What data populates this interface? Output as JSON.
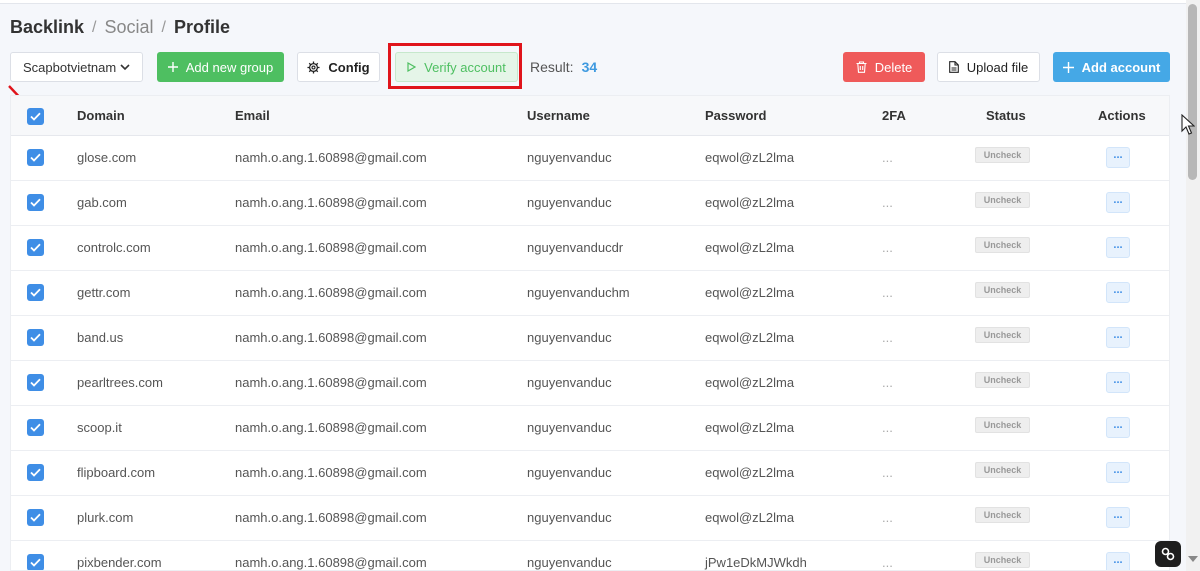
{
  "breadcrumb": {
    "root": "Backlink",
    "sep1": "/",
    "mid": "Social",
    "sep2": "/",
    "current": "Profile"
  },
  "toolbar": {
    "group_select": "Scapbotvietnam",
    "add_group": "Add new group",
    "config": "Config",
    "verify": "Verify account",
    "result_label": "Result:",
    "result_value": "34",
    "delete": "Delete",
    "upload": "Upload file",
    "add_account": "Add account"
  },
  "table": {
    "headers": {
      "domain": "Domain",
      "email": "Email",
      "username": "Username",
      "password": "Password",
      "twofa": "2FA",
      "status": "Status",
      "actions": "Actions"
    },
    "rows": [
      {
        "domain": "glose.com",
        "email": "namh.o.ang.1.60898@gmail.com",
        "username": "nguyenvanduc",
        "password": "eqwol@zL2lma",
        "twofa": "...",
        "status": "Uncheck",
        "action": "..."
      },
      {
        "domain": "gab.com",
        "email": "namh.o.ang.1.60898@gmail.com",
        "username": "nguyenvanduc",
        "password": "eqwol@zL2lma",
        "twofa": "...",
        "status": "Uncheck",
        "action": "..."
      },
      {
        "domain": "controlc.com",
        "email": "namh.o.ang.1.60898@gmail.com",
        "username": "nguyenvanducdr",
        "password": "eqwol@zL2lma",
        "twofa": "...",
        "status": "Uncheck",
        "action": "..."
      },
      {
        "domain": "gettr.com",
        "email": "namh.o.ang.1.60898@gmail.com",
        "username": "nguyenvanduchm",
        "password": "eqwol@zL2lma",
        "twofa": "...",
        "status": "Uncheck",
        "action": "..."
      },
      {
        "domain": "band.us",
        "email": "namh.o.ang.1.60898@gmail.com",
        "username": "nguyenvanduc",
        "password": "eqwol@zL2lma",
        "twofa": "...",
        "status": "Uncheck",
        "action": "..."
      },
      {
        "domain": "pearltrees.com",
        "email": "namh.o.ang.1.60898@gmail.com",
        "username": "nguyenvanduc",
        "password": "eqwol@zL2lma",
        "twofa": "...",
        "status": "Uncheck",
        "action": "..."
      },
      {
        "domain": "scoop.it",
        "email": "namh.o.ang.1.60898@gmail.com",
        "username": "nguyenvanduc",
        "password": "eqwol@zL2lma",
        "twofa": "...",
        "status": "Uncheck",
        "action": "..."
      },
      {
        "domain": "flipboard.com",
        "email": "namh.o.ang.1.60898@gmail.com",
        "username": "nguyenvanduc",
        "password": "eqwol@zL2lma",
        "twofa": "...",
        "status": "Uncheck",
        "action": "..."
      },
      {
        "domain": "plurk.com",
        "email": "namh.o.ang.1.60898@gmail.com",
        "username": "nguyenvanduc",
        "password": "eqwol@zL2lma",
        "twofa": "...",
        "status": "Uncheck",
        "action": "..."
      },
      {
        "domain": "pixbender.com",
        "email": "namh.o.ang.1.60898@gmail.com",
        "username": "nguyenvanduc",
        "password": "jPw1eDkMJWkdh",
        "twofa": "...",
        "status": "Uncheck",
        "action": "..."
      }
    ]
  },
  "colors": {
    "primary": "#45a8e6",
    "success": "#4ebf61",
    "danger": "#ef5a5a",
    "checkbox": "#3f8ee6",
    "highlight": "#e0141b"
  },
  "icons": [
    "chevron-down-icon",
    "plus-icon",
    "gear-icon",
    "play-icon",
    "trash-icon",
    "file-icon",
    "check-icon",
    "arrow-icon",
    "cursor-icon",
    "link-icon"
  ]
}
